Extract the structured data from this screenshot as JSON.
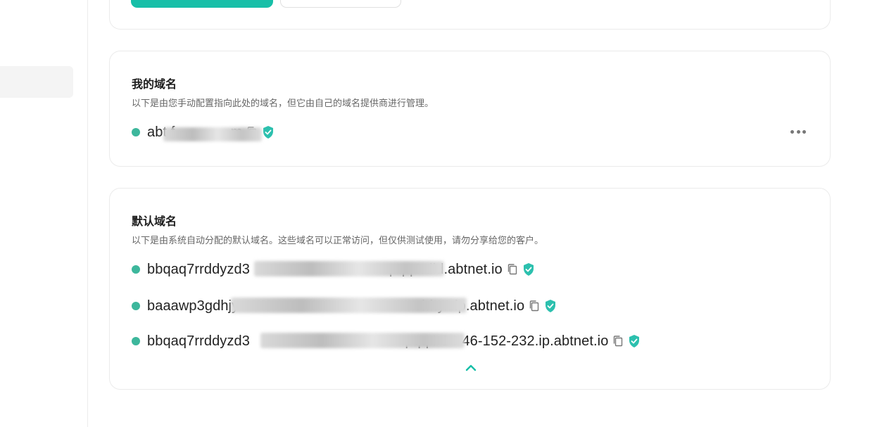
{
  "colors": {
    "accent": "#17bfa8",
    "status_dot": "#3db79c",
    "verified": "#2cc0ae"
  },
  "my_domains": {
    "title": "我的域名",
    "description": "以下是由您手动配置指向此处的域名，但它由自己的域名提供商进行管理。",
    "items": [
      {
        "domain": "abt.f              m",
        "icons": [
          "copy-icon",
          "verified-shield-icon"
        ]
      }
    ],
    "menu_icon": "more-horizontal-icon"
  },
  "default_domains": {
    "title": "默认域名",
    "description": "以下是由系统自动分配的默认域名。这些域名可以正常访问，但仅供测试使用，请勿分享给您的客户。",
    "items": [
      {
        "domain": "bbqaq7rrddyzd3                                   pqq4.did.abtnet.io",
        "icons": [
          "copy-icon",
          "verified-shield-icon"
        ]
      },
      {
        "domain": "baaawp3gdhjy                                            ohhy.slp.abtnet.io",
        "icons": [
          "copy-icon",
          "verified-shield-icon"
        ]
      },
      {
        "domain": "bbqaq7rrddyzd3                                       pqq4-34-46-152-232.ip.abtnet.io",
        "icons": [
          "copy-icon",
          "verified-shield-icon"
        ]
      }
    ],
    "collapse_icon": "chevron-up-icon"
  }
}
